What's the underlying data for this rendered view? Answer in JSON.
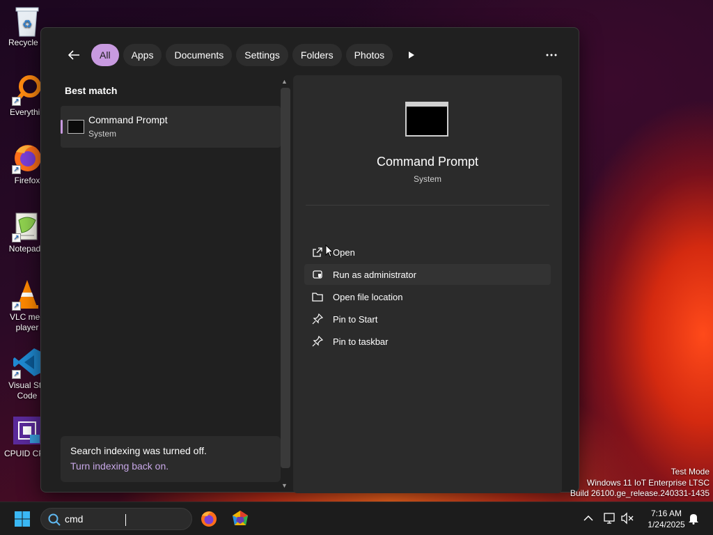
{
  "desktop": {
    "icons": [
      {
        "label": "Recycle B",
        "icon": "recycle-bin-icon"
      },
      {
        "label": "Everythin",
        "icon": "everything-icon"
      },
      {
        "label": "Firefox",
        "icon": "firefox-icon"
      },
      {
        "label": "Notepad+",
        "icon": "notepad-plus-plus-icon"
      },
      {
        "label": "VLC med\nplayer",
        "icon": "vlc-icon"
      },
      {
        "label": "Visual Stu\nCode",
        "icon": "vscode-icon"
      },
      {
        "label": "CPUID CPU",
        "icon": "cpuid-icon"
      }
    ]
  },
  "search_flyout": {
    "filters": [
      "All",
      "Apps",
      "Documents",
      "Settings",
      "Folders",
      "Photos"
    ],
    "active_filter": "All",
    "best_match_title": "Best match",
    "best_match": {
      "name": "Command Prompt",
      "type": "System"
    },
    "indexing": {
      "message": "Search indexing was turned off.",
      "link": "Turn indexing back on."
    },
    "details": {
      "name": "Command Prompt",
      "type": "System",
      "actions": [
        {
          "label": "Open",
          "icon": "open-external-icon"
        },
        {
          "label": "Run as administrator",
          "icon": "admin-shield-icon"
        },
        {
          "label": "Open file location",
          "icon": "folder-icon"
        },
        {
          "label": "Pin to Start",
          "icon": "pin-icon"
        },
        {
          "label": "Pin to taskbar",
          "icon": "pin-icon"
        }
      ]
    }
  },
  "watermark": {
    "line1": "Test Mode",
    "line2": "Windows 11 IoT Enterprise LTSC",
    "line3": "Build 26100.ge_release.240331-1435"
  },
  "taskbar": {
    "search_value": "cmd",
    "time": "7:16 AM",
    "date": "1/24/2025"
  },
  "colors": {
    "accent": "#c89ae0",
    "flyout_bg": "#202020",
    "panel_bg": "#2b2b2b"
  }
}
